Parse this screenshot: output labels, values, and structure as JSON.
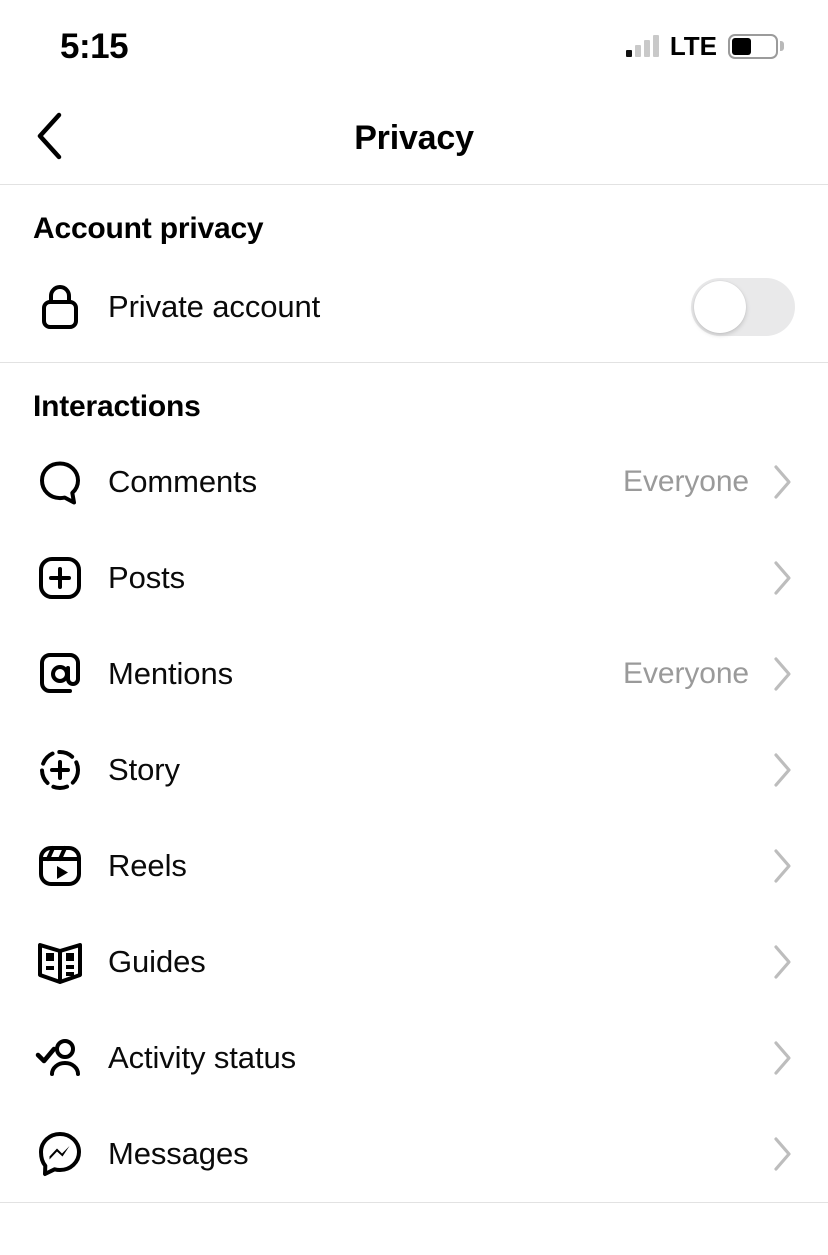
{
  "status_bar": {
    "time": "5:15",
    "network": "LTE",
    "signal_bars": 4,
    "signal_active_bars": 1,
    "battery_percent": 45
  },
  "nav": {
    "title": "Privacy",
    "back_icon": "chevron-left-icon"
  },
  "sections": [
    {
      "title": "Account privacy",
      "rows": [
        {
          "icon": "lock-icon",
          "label": "Private account",
          "control": "toggle",
          "toggle_on": false
        }
      ]
    },
    {
      "title": "Interactions",
      "rows": [
        {
          "icon": "comment-icon",
          "label": "Comments",
          "value": "Everyone",
          "control": "chevron"
        },
        {
          "icon": "posts-icon",
          "label": "Posts",
          "value": "",
          "control": "chevron"
        },
        {
          "icon": "mention-icon",
          "label": "Mentions",
          "value": "Everyone",
          "control": "chevron"
        },
        {
          "icon": "story-icon",
          "label": "Story",
          "value": "",
          "control": "chevron"
        },
        {
          "icon": "reels-icon",
          "label": "Reels",
          "value": "",
          "control": "chevron"
        },
        {
          "icon": "guides-icon",
          "label": "Guides",
          "value": "",
          "control": "chevron"
        },
        {
          "icon": "activity-status-icon",
          "label": "Activity status",
          "value": "",
          "control": "chevron"
        },
        {
          "icon": "messenger-icon",
          "label": "Messages",
          "value": "",
          "control": "chevron"
        }
      ]
    }
  ],
  "colors": {
    "background": "#ffffff",
    "text": "#000000",
    "value_text": "#9a9a9a",
    "chevron": "#bdbdbd",
    "divider": "#e2e2e2",
    "toggle_off_track": "#e9e9ea"
  }
}
